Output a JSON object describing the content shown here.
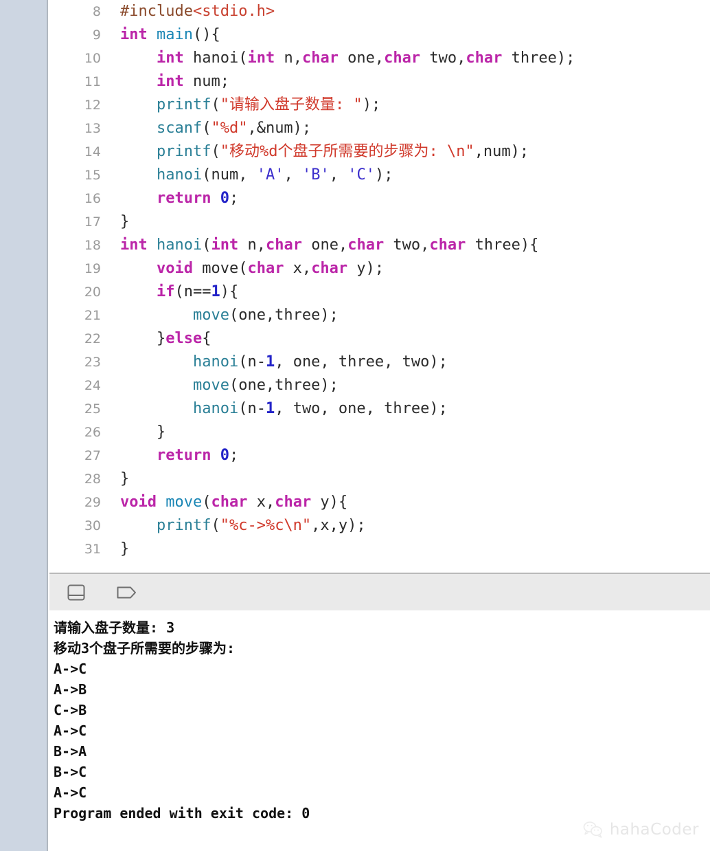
{
  "window": {
    "type": "ide-code-editor-with-console",
    "language": "C"
  },
  "editor": {
    "first_visible_line": 8,
    "lines": [
      {
        "no": "8",
        "tokens": [
          {
            "t": "#include",
            "c": "t-pre"
          },
          {
            "t": "<stdio.h>",
            "c": "t-hdr"
          }
        ]
      },
      {
        "no": "9",
        "tokens": [
          {
            "t": "int",
            "c": "t-kw"
          },
          {
            "t": " ",
            "c": "t-plain"
          },
          {
            "t": "main",
            "c": "t-fn2"
          },
          {
            "t": "(){",
            "c": "t-plain"
          }
        ]
      },
      {
        "no": "10",
        "tokens": [
          {
            "t": "    ",
            "c": "t-plain"
          },
          {
            "t": "int",
            "c": "t-kw"
          },
          {
            "t": " hanoi(",
            "c": "t-plain"
          },
          {
            "t": "int",
            "c": "t-kw"
          },
          {
            "t": " n,",
            "c": "t-plain"
          },
          {
            "t": "char",
            "c": "t-kw"
          },
          {
            "t": " one,",
            "c": "t-plain"
          },
          {
            "t": "char",
            "c": "t-kw"
          },
          {
            "t": " two,",
            "c": "t-plain"
          },
          {
            "t": "char",
            "c": "t-kw"
          },
          {
            "t": " three);",
            "c": "t-plain"
          }
        ]
      },
      {
        "no": "11",
        "tokens": [
          {
            "t": "    ",
            "c": "t-plain"
          },
          {
            "t": "int",
            "c": "t-kw"
          },
          {
            "t": " num;",
            "c": "t-plain"
          }
        ]
      },
      {
        "no": "12",
        "tokens": [
          {
            "t": "    ",
            "c": "t-plain"
          },
          {
            "t": "printf",
            "c": "t-fn"
          },
          {
            "t": "(",
            "c": "t-plain"
          },
          {
            "t": "\"请输入盘子数量: \"",
            "c": "t-str"
          },
          {
            "t": ");",
            "c": "t-plain"
          }
        ]
      },
      {
        "no": "13",
        "tokens": [
          {
            "t": "    ",
            "c": "t-plain"
          },
          {
            "t": "scanf",
            "c": "t-fn"
          },
          {
            "t": "(",
            "c": "t-plain"
          },
          {
            "t": "\"%d\"",
            "c": "t-str"
          },
          {
            "t": ",&num);",
            "c": "t-plain"
          }
        ]
      },
      {
        "no": "14",
        "tokens": [
          {
            "t": "    ",
            "c": "t-plain"
          },
          {
            "t": "printf",
            "c": "t-fn"
          },
          {
            "t": "(",
            "c": "t-plain"
          },
          {
            "t": "\"移动%d个盘子所需要的步骤为: \\n\"",
            "c": "t-str"
          },
          {
            "t": ",num);",
            "c": "t-plain"
          }
        ]
      },
      {
        "no": "15",
        "tokens": [
          {
            "t": "    ",
            "c": "t-plain"
          },
          {
            "t": "hanoi",
            "c": "t-fn"
          },
          {
            "t": "(num, ",
            "c": "t-plain"
          },
          {
            "t": "'A'",
            "c": "t-chr"
          },
          {
            "t": ", ",
            "c": "t-plain"
          },
          {
            "t": "'B'",
            "c": "t-chr"
          },
          {
            "t": ", ",
            "c": "t-plain"
          },
          {
            "t": "'C'",
            "c": "t-chr"
          },
          {
            "t": ");",
            "c": "t-plain"
          }
        ]
      },
      {
        "no": "16",
        "tokens": [
          {
            "t": "    ",
            "c": "t-plain"
          },
          {
            "t": "return",
            "c": "t-kw"
          },
          {
            "t": " ",
            "c": "t-plain"
          },
          {
            "t": "0",
            "c": "t-num"
          },
          {
            "t": ";",
            "c": "t-plain"
          }
        ]
      },
      {
        "no": "17",
        "tokens": [
          {
            "t": "}",
            "c": "t-plain"
          }
        ]
      },
      {
        "no": "18",
        "tokens": [
          {
            "t": "int",
            "c": "t-kw"
          },
          {
            "t": " ",
            "c": "t-plain"
          },
          {
            "t": "hanoi",
            "c": "t-fn"
          },
          {
            "t": "(",
            "c": "t-plain"
          },
          {
            "t": "int",
            "c": "t-kw"
          },
          {
            "t": " n,",
            "c": "t-plain"
          },
          {
            "t": "char",
            "c": "t-kw"
          },
          {
            "t": " one,",
            "c": "t-plain"
          },
          {
            "t": "char",
            "c": "t-kw"
          },
          {
            "t": " two,",
            "c": "t-plain"
          },
          {
            "t": "char",
            "c": "t-kw"
          },
          {
            "t": " three){",
            "c": "t-plain"
          }
        ]
      },
      {
        "no": "19",
        "tokens": [
          {
            "t": "    ",
            "c": "t-plain"
          },
          {
            "t": "void",
            "c": "t-kw"
          },
          {
            "t": " move(",
            "c": "t-plain"
          },
          {
            "t": "char",
            "c": "t-kw"
          },
          {
            "t": " x,",
            "c": "t-plain"
          },
          {
            "t": "char",
            "c": "t-kw"
          },
          {
            "t": " y);",
            "c": "t-plain"
          }
        ]
      },
      {
        "no": "20",
        "tokens": [
          {
            "t": "    ",
            "c": "t-plain"
          },
          {
            "t": "if",
            "c": "t-kw"
          },
          {
            "t": "(n==",
            "c": "t-plain"
          },
          {
            "t": "1",
            "c": "t-num"
          },
          {
            "t": "){",
            "c": "t-plain"
          }
        ]
      },
      {
        "no": "21",
        "tokens": [
          {
            "t": "        ",
            "c": "t-plain"
          },
          {
            "t": "move",
            "c": "t-fn"
          },
          {
            "t": "(one,three);",
            "c": "t-plain"
          }
        ]
      },
      {
        "no": "22",
        "tokens": [
          {
            "t": "    }",
            "c": "t-plain"
          },
          {
            "t": "else",
            "c": "t-kw"
          },
          {
            "t": "{",
            "c": "t-plain"
          }
        ]
      },
      {
        "no": "23",
        "tokens": [
          {
            "t": "        ",
            "c": "t-plain"
          },
          {
            "t": "hanoi",
            "c": "t-fn"
          },
          {
            "t": "(n-",
            "c": "t-plain"
          },
          {
            "t": "1",
            "c": "t-num"
          },
          {
            "t": ", one, three, two);",
            "c": "t-plain"
          }
        ]
      },
      {
        "no": "24",
        "tokens": [
          {
            "t": "        ",
            "c": "t-plain"
          },
          {
            "t": "move",
            "c": "t-fn"
          },
          {
            "t": "(one,three);",
            "c": "t-plain"
          }
        ]
      },
      {
        "no": "25",
        "tokens": [
          {
            "t": "        ",
            "c": "t-plain"
          },
          {
            "t": "hanoi",
            "c": "t-fn"
          },
          {
            "t": "(n-",
            "c": "t-plain"
          },
          {
            "t": "1",
            "c": "t-num"
          },
          {
            "t": ", two, one, three);",
            "c": "t-plain"
          }
        ]
      },
      {
        "no": "26",
        "tokens": [
          {
            "t": "    }",
            "c": "t-plain"
          }
        ]
      },
      {
        "no": "27",
        "tokens": [
          {
            "t": "    ",
            "c": "t-plain"
          },
          {
            "t": "return",
            "c": "t-kw"
          },
          {
            "t": " ",
            "c": "t-plain"
          },
          {
            "t": "0",
            "c": "t-num"
          },
          {
            "t": ";",
            "c": "t-plain"
          }
        ]
      },
      {
        "no": "28",
        "tokens": [
          {
            "t": "}",
            "c": "t-plain"
          }
        ]
      },
      {
        "no": "29",
        "tokens": [
          {
            "t": "void",
            "c": "t-kw"
          },
          {
            "t": " ",
            "c": "t-plain"
          },
          {
            "t": "move",
            "c": "t-fn2"
          },
          {
            "t": "(",
            "c": "t-plain"
          },
          {
            "t": "char",
            "c": "t-kw"
          },
          {
            "t": " x,",
            "c": "t-plain"
          },
          {
            "t": "char",
            "c": "t-kw"
          },
          {
            "t": " y){",
            "c": "t-plain"
          }
        ]
      },
      {
        "no": "30",
        "tokens": [
          {
            "t": "    ",
            "c": "t-plain"
          },
          {
            "t": "printf",
            "c": "t-fn"
          },
          {
            "t": "(",
            "c": "t-plain"
          },
          {
            "t": "\"%c->%c\\n\"",
            "c": "t-str"
          },
          {
            "t": ",x,y);",
            "c": "t-plain"
          }
        ]
      },
      {
        "no": "31",
        "tokens": [
          {
            "t": "}",
            "c": "t-plain"
          }
        ]
      }
    ]
  },
  "console_toolbar": {
    "buttons": [
      {
        "icon": "split-console-icon",
        "label": ""
      },
      {
        "icon": "filter-tag-icon",
        "label": ""
      }
    ]
  },
  "console": {
    "lines": [
      "请输入盘子数量: 3",
      "移动3个盘子所需要的步骤为:",
      "A->C",
      "A->B",
      "C->B",
      "A->C",
      "B->A",
      "B->C",
      "A->C",
      "Program ended with exit code: 0"
    ]
  },
  "watermark": {
    "icon": "wechat-icon",
    "text": "hahaCoder"
  },
  "colors": {
    "sidebar": "#cdd6e2",
    "toolbar": "#eaeaea",
    "editor_bg": "#ffffff",
    "keyword": "#bb25a8",
    "function": "#2a7f96",
    "function_def": "#1a86b5",
    "preprocessor": "#8a4a2b",
    "header": "#c8402f",
    "string": "#d0392b",
    "number": "#2323c8",
    "char_literal": "#3b2ecc",
    "line_number": "#9b9b9b",
    "plain_text": "#2b2b2b"
  }
}
